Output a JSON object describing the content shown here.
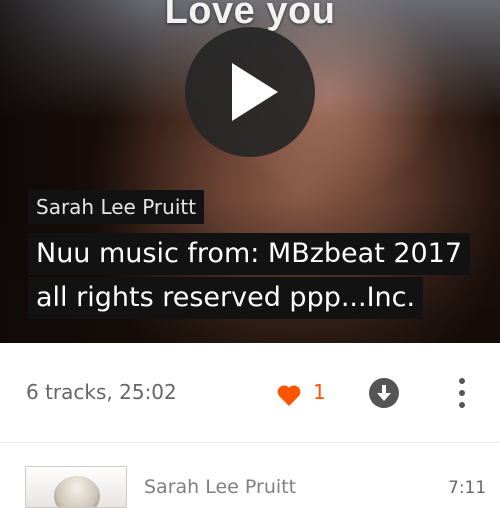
{
  "hero": {
    "caption": "Love you",
    "artist": "Sarah Lee Pruitt",
    "title_lines": [
      "Nuu music from: MBzbeat 2017",
      "all rights reserved ppp...Inc."
    ],
    "play_icon": "play-icon"
  },
  "info": {
    "track_summary": "6 tracks, 25:02",
    "like_count": "1",
    "like_icon": "heart-icon",
    "download_icon": "download-icon",
    "more_icon": "more-vertical-icon"
  },
  "tracks": [
    {
      "artist": "Sarah Lee Pruitt",
      "duration": "7:11"
    }
  ],
  "colors": {
    "accent": "#ff5500",
    "icon_gray": "#555555",
    "label_bg": "#121212"
  }
}
